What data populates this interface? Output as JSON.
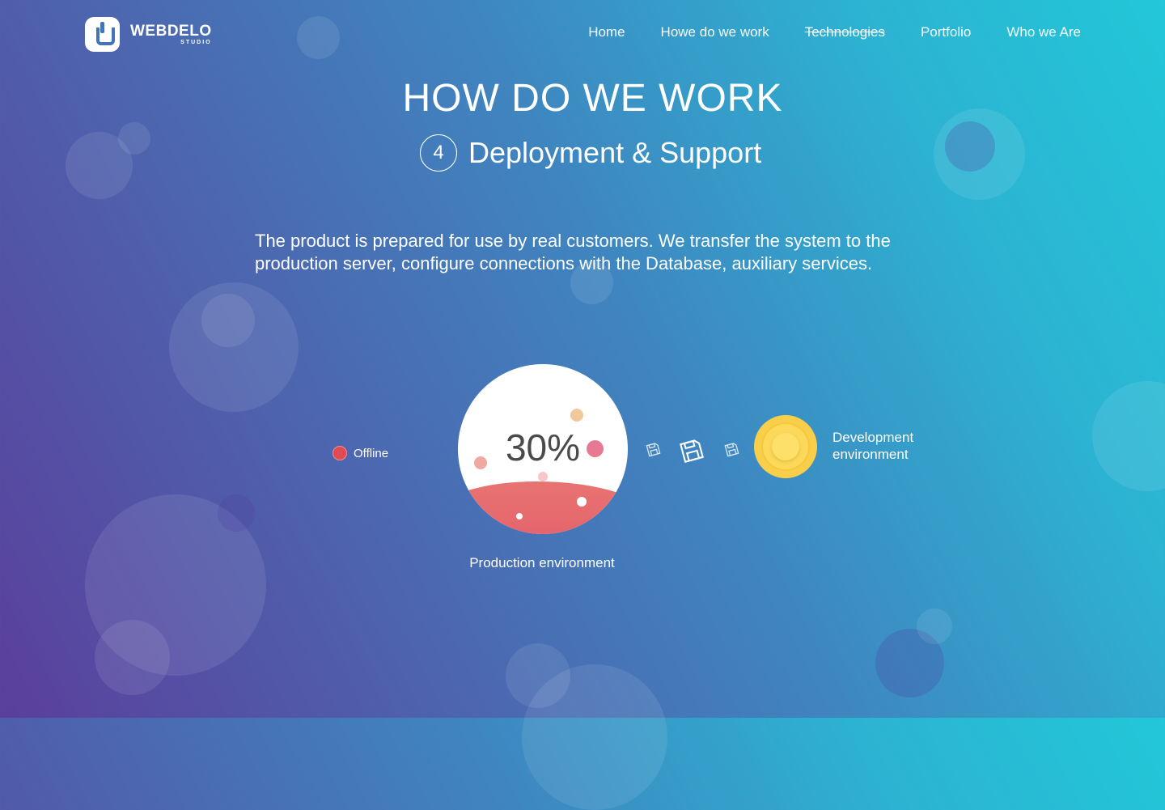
{
  "brand": {
    "name": "WEBDELO",
    "sub": "STUDIO"
  },
  "nav": {
    "items": [
      {
        "label": "Home"
      },
      {
        "label": "Howe do we work"
      },
      {
        "label": "Technologies"
      },
      {
        "label": "Portfolio"
      },
      {
        "label": "Who we Are"
      }
    ]
  },
  "hero": {
    "title": "HOW DO WE WORK",
    "step_number": "4",
    "step_title": "Deployment & Support",
    "description": "The product is prepared for use by real customers. We transfer the system to the production server, configure connections with the Database, auxiliary services."
  },
  "diagram": {
    "offline_label": "Offline",
    "production_percent": "30%",
    "production_label": "Production environment",
    "development_label": "Development environment"
  },
  "colors": {
    "gradient_start": "#5a3f9c",
    "gradient_end": "#22c7d8",
    "offline_dot": "#e04a55",
    "wave": "#e25a67",
    "coin": "#f9cf4a"
  },
  "icons": {
    "transfer": "floppy-disk-icon"
  }
}
